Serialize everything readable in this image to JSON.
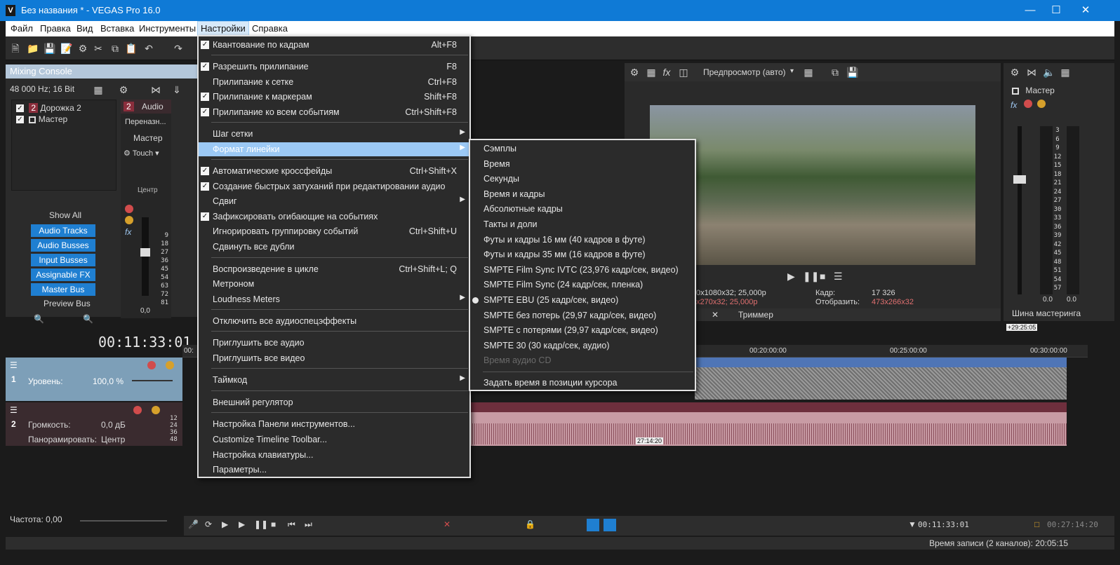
{
  "window": {
    "title": "Без названия * - VEGAS Pro 16.0",
    "app_icon": "V",
    "controls": [
      "minimize-icon",
      "maximize-icon",
      "close-icon"
    ]
  },
  "menubar": {
    "items": [
      "Файл",
      "Правка",
      "Вид",
      "Вставка",
      "Инструменты",
      "Настройки",
      "Справка"
    ],
    "active": "Настройки"
  },
  "mixing_console": {
    "title": "Mixing Console",
    "format": "48 000 Hz; 16 Bit",
    "tree": [
      {
        "label": "Дорожка 2",
        "num": "2"
      },
      {
        "label": "Мастер"
      }
    ],
    "channel": {
      "num": "2",
      "name": "Audio",
      "rename": "Переназн...",
      "target": "Мастер",
      "mode": "Touch",
      "pan": "Центр",
      "fader_value": "0,0",
      "scale": [
        "9",
        "18",
        "27",
        "36",
        "45",
        "54",
        "63",
        "72",
        "81"
      ]
    },
    "show_all": "Show All",
    "buttons": [
      "Audio Tracks",
      "Audio Busses",
      "Input Busses",
      "Assignable FX",
      "Master Bus"
    ],
    "preview_bus": "Preview Bus"
  },
  "preview": {
    "mode": "Предпросмотр (авто)",
    "info_left1": "0x1080x32; 25,000p",
    "info_left2": "x270x32; 25,000p",
    "frame_label": "Кадр:",
    "frame_value": "17 326",
    "display_label": "Отобразить:",
    "display_value": "473x266x32",
    "trimmer": "Триммер"
  },
  "master": {
    "title": "Мастер",
    "scale": [
      "3",
      "6",
      "9",
      "12",
      "15",
      "18",
      "21",
      "24",
      "27",
      "30",
      "33",
      "36",
      "39",
      "42",
      "45",
      "48",
      "51",
      "54",
      "57"
    ],
    "values": [
      "0.0",
      "0.0"
    ],
    "bus_label": "Шина мастеринга"
  },
  "timeline": {
    "timecode": "00:11:33:01",
    "ruler_start": "00:",
    "ruler_marks": [
      "00:20:00:00",
      "00:25:00:00",
      "00:30:00:00"
    ],
    "end_marker": "+29:25:05",
    "track1": {
      "num": "1",
      "level_label": "Уровень:",
      "level_value": "100,0 %"
    },
    "track2": {
      "num": "2",
      "volume_label": "Громкость:",
      "volume_value": "0,0 дБ",
      "pan_label": "Панорамировать:",
      "pan_value": "Центр",
      "scale": [
        "12",
        "24",
        "36",
        "48"
      ]
    },
    "clip_marker": "27:14:20"
  },
  "bottom": {
    "rate_label": "Частота: 0,00",
    "cursor_time": "00:11:33:01",
    "end_time": "00:27:14:20",
    "status": "Время записи (2 каналов): 20:05:15"
  },
  "settings_menu": {
    "items": [
      {
        "label": "Квантование по кадрам",
        "shortcut": "Alt+F8",
        "checked": true
      },
      {
        "label": "Разрешить прилипание",
        "shortcut": "F8",
        "checked": true
      },
      {
        "label": "Прилипание к сетке",
        "shortcut": "Ctrl+F8",
        "checked": false
      },
      {
        "label": "Прилипание к маркерам",
        "shortcut": "Shift+F8",
        "checked": true
      },
      {
        "label": "Прилипание ко всем событиям",
        "shortcut": "Ctrl+Shift+F8",
        "checked": true
      },
      {
        "label": "Шаг сетки",
        "shortcut": "",
        "submenu": true
      },
      {
        "label": "Формат линейки",
        "shortcut": "",
        "submenu": true,
        "highlighted": true
      },
      {
        "label": "Автоматические кроссфейды",
        "shortcut": "Ctrl+Shift+X",
        "checked": true
      },
      {
        "label": "Создание быстрых затуханий при редактировании аудио",
        "shortcut": "",
        "checked": true
      },
      {
        "label": "Сдвиг",
        "shortcut": "",
        "submenu": true
      },
      {
        "label": "Зафиксировать огибающие на событиях",
        "shortcut": "",
        "checked": true
      },
      {
        "label": "Игнорировать группировку событий",
        "shortcut": "Ctrl+Shift+U"
      },
      {
        "label": "Сдвинуть все дубли",
        "shortcut": ""
      },
      {
        "label": "Воспроизведение в цикле",
        "shortcut": "Ctrl+Shift+L; Q"
      },
      {
        "label": "Метроном",
        "shortcut": ""
      },
      {
        "label": "Loudness Meters",
        "shortcut": "",
        "submenu": true
      },
      {
        "label": "Отключить все аудиоспецэффекты",
        "shortcut": ""
      },
      {
        "label": "Приглушить все аудио",
        "shortcut": ""
      },
      {
        "label": "Приглушить все видео",
        "shortcut": ""
      },
      {
        "label": "Таймкод",
        "shortcut": "",
        "submenu": true
      },
      {
        "label": "Внешний регулятор",
        "shortcut": ""
      },
      {
        "label": "Настройка Панели инструментов...",
        "shortcut": ""
      },
      {
        "label": "Customize Timeline Toolbar...",
        "shortcut": ""
      },
      {
        "label": "Настройка клавиатуры...",
        "shortcut": ""
      },
      {
        "label": "Параметры...",
        "shortcut": ""
      }
    ]
  },
  "ruler_format_submenu": {
    "items": [
      {
        "label": "Сэмплы"
      },
      {
        "label": "Время"
      },
      {
        "label": "Секунды"
      },
      {
        "label": "Время и кадры"
      },
      {
        "label": "Абсолютные кадры"
      },
      {
        "label": "Такты и доли"
      },
      {
        "label": "Футы и кадры 16 мм (40 кадров в футе)"
      },
      {
        "label": "Футы и кадры 35 мм (16 кадров в футе)"
      },
      {
        "label": "SMPTE Film Sync IVTC (23,976 кадр/сек, видео)"
      },
      {
        "label": "SMPTE Film Sync (24 кадр/сек, пленка)"
      },
      {
        "label": "SMPTE EBU (25 кадр/сек, видео)",
        "selected": true
      },
      {
        "label": "SMPTE без потерь (29,97 кадр/сек, видео)"
      },
      {
        "label": "SMPTE с потерями (29,97 кадр/сек, видео)"
      },
      {
        "label": "SMPTE 30 (30 кадр/сек, аудио)"
      },
      {
        "label": "Время аудио CD",
        "disabled": true
      },
      {
        "label": "Задать время в позиции курсора"
      }
    ]
  }
}
